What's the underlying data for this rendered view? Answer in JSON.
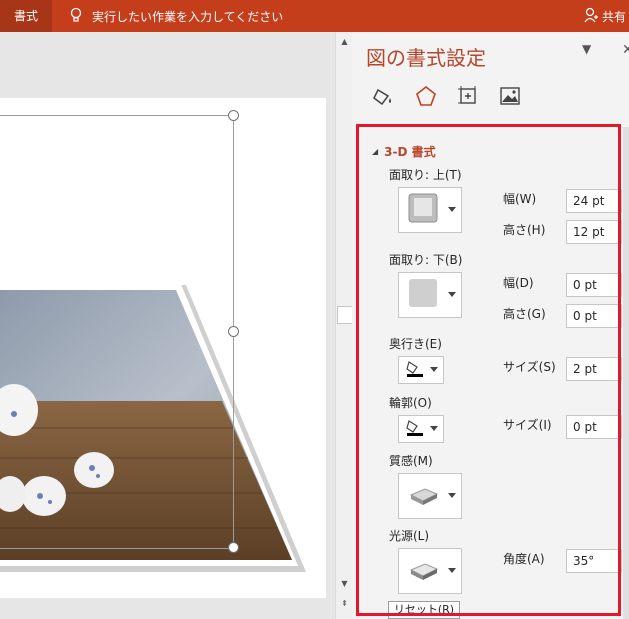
{
  "ribbon": {
    "tab_label": "書式",
    "tell_me": "実行したい作業を入力してください",
    "share": "共有"
  },
  "pane": {
    "title": "図の書式設定",
    "tabs": [
      "fill-and-line",
      "effects",
      "size-and-properties",
      "picture"
    ],
    "section": "3-D 書式",
    "bevel_top": {
      "label": "面取り: 上(T)",
      "width_label": "幅(W)",
      "width": "24 pt",
      "height_label": "高さ(H)",
      "height": "12 pt"
    },
    "bevel_bottom": {
      "label": "面取り: 下(B)",
      "width_label": "幅(D)",
      "width": "0 pt",
      "height_label": "高さ(G)",
      "height": "0 pt"
    },
    "depth": {
      "label": "奥行き(E)",
      "size_label": "サイズ(S)",
      "size": "2 pt"
    },
    "contour": {
      "label": "輪郭(O)",
      "size_label": "サイズ(I)",
      "size": "0 pt"
    },
    "material": {
      "label": "質感(M)"
    },
    "lighting": {
      "label": "光源(L)",
      "angle_label": "角度(A)",
      "angle": "35°"
    },
    "reset": "リセット(R)"
  },
  "colors": {
    "accent": "#b7472a",
    "ribbon": "#c43e1c",
    "highlight": "#e01a2b"
  }
}
